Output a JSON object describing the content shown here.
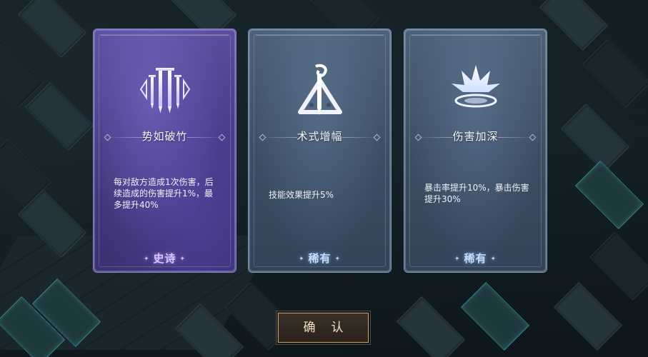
{
  "cards": [
    {
      "title": "势如破竹",
      "desc": "每对敌方造成1次伤害，后续造成的伤害提升1%，最多提升40%",
      "rarity": "史诗",
      "icon": "swords-icon"
    },
    {
      "title": "术式增幅",
      "desc": "技能效果提升5%",
      "rarity": "稀有",
      "icon": "staff-triangle-icon"
    },
    {
      "title": "伤害加深",
      "desc": "暴击率提升10%，暴击伤害提升30%",
      "rarity": "稀有",
      "icon": "burst-icon"
    }
  ],
  "confirm_label": "确认",
  "colors": {
    "epic": "#463b82",
    "rare": "#3d4f64",
    "epic_rarity_text": "#d7c8ff",
    "rare_rarity_text": "#c3dcff",
    "button_border": "#c8a56e"
  }
}
